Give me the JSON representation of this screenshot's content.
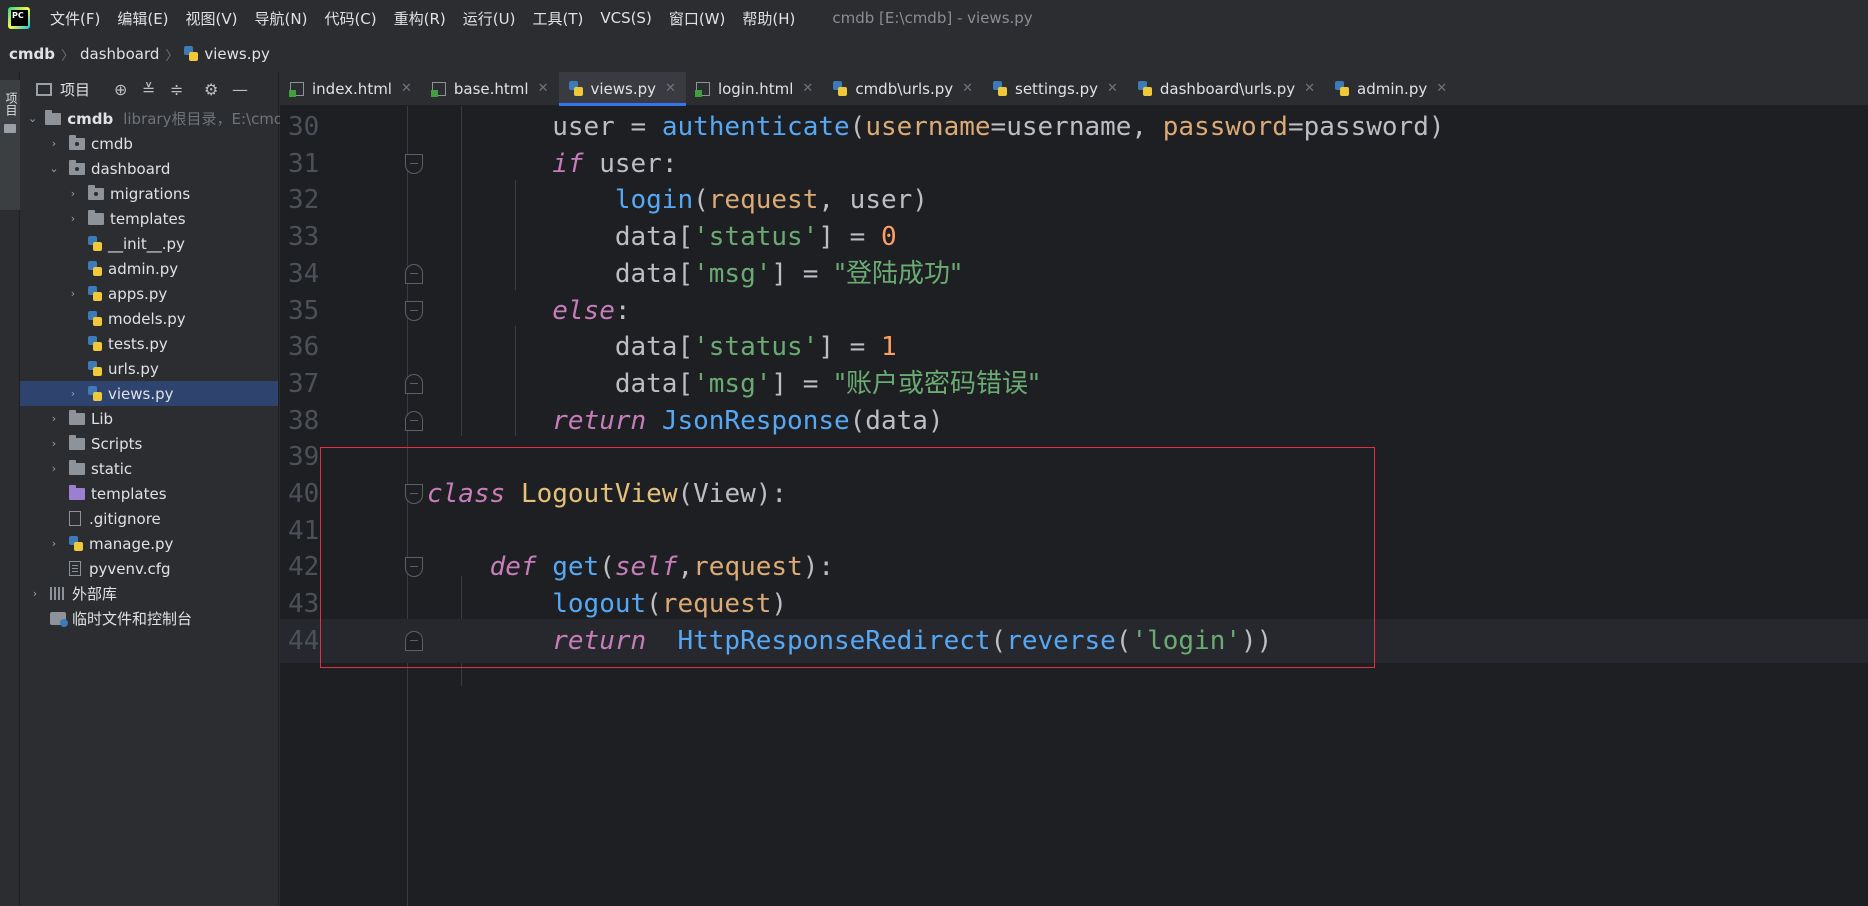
{
  "menu": {
    "items": [
      "文件(F)",
      "编辑(E)",
      "视图(V)",
      "导航(N)",
      "代码(C)",
      "重构(R)",
      "运行(U)",
      "工具(T)",
      "VCS(S)",
      "窗口(W)",
      "帮助(H)"
    ],
    "window_title": "cmdb [E:\\cmdb] - views.py"
  },
  "breadcrumb": [
    "cmdb",
    "dashboard",
    "views.py"
  ],
  "activity": {
    "project_label": "项目"
  },
  "project_panel": {
    "title": "项目",
    "root": {
      "name": "cmdb",
      "hint": "library根目录，E:\\cmdb"
    },
    "tree": [
      {
        "label": "cmdb",
        "indent": 1,
        "chev": "right",
        "icon": "folder-pkg"
      },
      {
        "label": "dashboard",
        "indent": 1,
        "chev": "down",
        "icon": "folder-pkg"
      },
      {
        "label": "migrations",
        "indent": 2,
        "chev": "right",
        "icon": "folder-pkg"
      },
      {
        "label": "templates",
        "indent": 2,
        "chev": "right",
        "icon": "folder"
      },
      {
        "label": "__init__.py",
        "indent": 2,
        "chev": "none",
        "icon": "python"
      },
      {
        "label": "admin.py",
        "indent": 2,
        "chev": "none",
        "icon": "python"
      },
      {
        "label": "apps.py",
        "indent": 2,
        "chev": "right",
        "icon": "python"
      },
      {
        "label": "models.py",
        "indent": 2,
        "chev": "none",
        "icon": "python"
      },
      {
        "label": "tests.py",
        "indent": 2,
        "chev": "none",
        "icon": "python"
      },
      {
        "label": "urls.py",
        "indent": 2,
        "chev": "none",
        "icon": "python"
      },
      {
        "label": "views.py",
        "indent": 2,
        "chev": "right",
        "icon": "python",
        "selected": true
      },
      {
        "label": "Lib",
        "indent": 1,
        "chev": "right",
        "icon": "folder"
      },
      {
        "label": "Scripts",
        "indent": 1,
        "chev": "right",
        "icon": "folder"
      },
      {
        "label": "static",
        "indent": 1,
        "chev": "right",
        "icon": "folder"
      },
      {
        "label": "templates",
        "indent": 1,
        "chev": "none",
        "icon": "folder-template"
      },
      {
        "label": ".gitignore",
        "indent": 1,
        "chev": "none",
        "icon": "file"
      },
      {
        "label": "manage.py",
        "indent": 1,
        "chev": "right",
        "icon": "python"
      },
      {
        "label": "pyvenv.cfg",
        "indent": 1,
        "chev": "none",
        "icon": "file-lines"
      },
      {
        "label": "外部库",
        "indent": 0,
        "chev": "right",
        "icon": "library"
      },
      {
        "label": "临时文件和控制台",
        "indent": 0,
        "chev": "none",
        "icon": "scratch"
      }
    ]
  },
  "tabs": [
    {
      "label": "index.html",
      "icon": "html"
    },
    {
      "label": "base.html",
      "icon": "html"
    },
    {
      "label": "views.py",
      "icon": "python",
      "active": true
    },
    {
      "label": "login.html",
      "icon": "html"
    },
    {
      "label": "cmdb\\urls.py",
      "icon": "python"
    },
    {
      "label": "settings.py",
      "icon": "python"
    },
    {
      "label": "dashboard\\urls.py",
      "icon": "python"
    },
    {
      "label": "admin.py",
      "icon": "python"
    }
  ],
  "code_lines": [
    {
      "num": "30",
      "text": "        user = authenticate(username=username, password=password)"
    },
    {
      "num": "31",
      "text": "        if user:"
    },
    {
      "num": "32",
      "text": "            login(request, user)"
    },
    {
      "num": "33",
      "text": "            data['status'] = 0"
    },
    {
      "num": "34",
      "text": "            data['msg'] = \"登陆成功\""
    },
    {
      "num": "35",
      "text": "        else:"
    },
    {
      "num": "36",
      "text": "            data['status'] = 1"
    },
    {
      "num": "37",
      "text": "            data['msg'] = \"账户或密码错误\""
    },
    {
      "num": "38",
      "text": "        return JsonResponse(data)"
    },
    {
      "num": "39",
      "text": ""
    },
    {
      "num": "40",
      "text": "class LogoutView(View):"
    },
    {
      "num": "41",
      "text": ""
    },
    {
      "num": "42",
      "text": "    def get(self,request):"
    },
    {
      "num": "43",
      "text": "        logout(request)"
    },
    {
      "num": "44",
      "text": "        return  HttpResponseRedirect(reverse('login'))"
    }
  ],
  "colors": {
    "keyword": "#c77dba",
    "function": "#56a8f5",
    "parameter": "#dcaa75",
    "string": "#6aab73",
    "number": "#ff9e64",
    "highlight_box": "#e0313e",
    "selection": "#2e436e",
    "active_tab_underline": "#3574f0"
  }
}
